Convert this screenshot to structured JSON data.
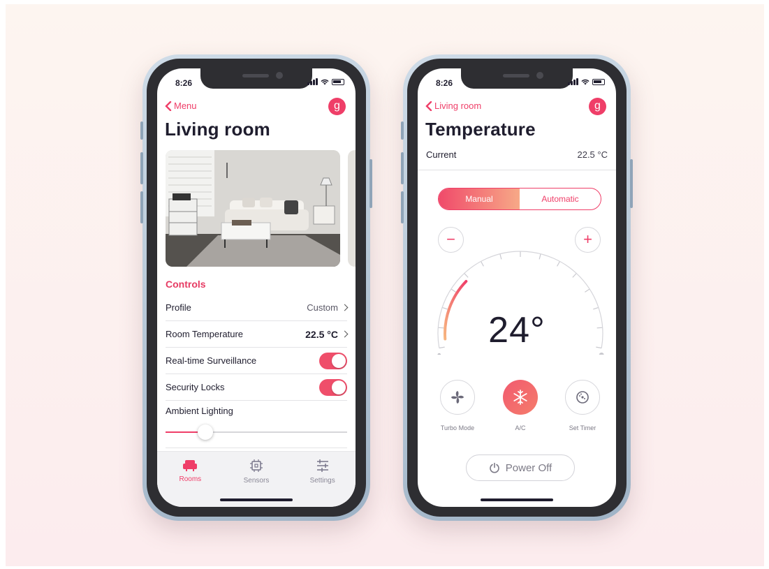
{
  "left_phone": {
    "status": {
      "time": "8:26"
    },
    "nav": {
      "back_label": "Menu",
      "avatar_initial": "g"
    },
    "title": "Living room",
    "section_label": "Controls",
    "rows": [
      {
        "label": "Profile",
        "value": "Custom"
      },
      {
        "label": "Room Temperature",
        "value": "22.5 °C"
      },
      {
        "label": "Real-time Surveillance",
        "toggle": true
      },
      {
        "label": "Security Locks",
        "toggle": true
      },
      {
        "label": "Ambient Lighting"
      }
    ],
    "ambient_lighting_level": 0.22,
    "tabs": [
      {
        "label": "Rooms",
        "icon": "sofa-icon",
        "active": true
      },
      {
        "label": "Sensors",
        "icon": "chip-icon",
        "active": false
      },
      {
        "label": "Settings",
        "icon": "sliders-icon",
        "active": false
      }
    ]
  },
  "right_phone": {
    "status": {
      "time": "8:26"
    },
    "nav": {
      "back_label": "Living room",
      "avatar_initial": "g"
    },
    "title": "Temperature",
    "current": {
      "label": "Current",
      "value": "22.5 °C"
    },
    "mode_toggle": {
      "manual": "Manual",
      "automatic": "Automatic",
      "selected": "Manual"
    },
    "minus_label": "−",
    "plus_label": "+",
    "set_temperature": "24°",
    "dial_fill_fraction": 0.27,
    "modes": [
      {
        "label": "Turbo Mode",
        "icon": "fan-icon",
        "active": false
      },
      {
        "label": "A/C",
        "icon": "snowflake-icon",
        "active": true
      },
      {
        "label": "Set Timer",
        "icon": "timer-icon",
        "active": false
      }
    ],
    "power_label": "Power Off"
  },
  "colors": {
    "accent": "#ef3e68",
    "gradient_end": "#f7a987",
    "text": "#1f1d2e",
    "page_background": "#fdf5f0"
  }
}
